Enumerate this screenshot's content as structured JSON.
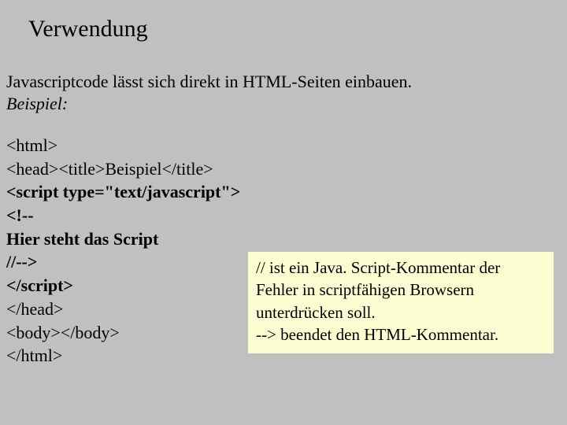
{
  "title": "Verwendung",
  "intro": {
    "line1": "Javascriptcode lässt sich direkt in HTML-Seiten einbauen.",
    "example_label": "Beispiel:"
  },
  "code": {
    "l1": "<html>",
    "l2": "<head><title>Beispiel</title>",
    "l3": "<script type=\"text/javascript\">",
    "l4": "<!--",
    "l5": "Hier steht das Script",
    "l6": "//-->",
    "l7": "</script>",
    "l8": "</head>",
    "l9": "<body></body>",
    "l10": "</html>"
  },
  "note": {
    "l1_bold": "//",
    "l1_rest": " ist ein Java. Script-Kommentar der",
    "l2": "Fehler in scriptfähigen Browsern",
    "l3": "unterdrücken soll.",
    "l4": "--> beendet den HTML-Kommentar."
  }
}
